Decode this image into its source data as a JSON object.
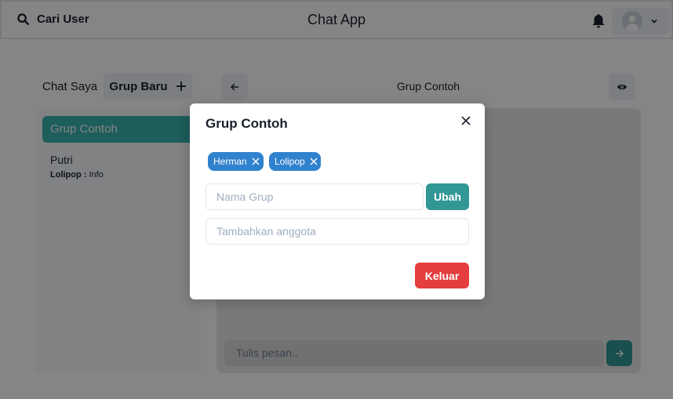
{
  "header": {
    "search_label": "Cari User",
    "app_title": "Chat App"
  },
  "sidebar": {
    "title": "Chat Saya",
    "new_group_label": "Grup Baru",
    "chats": [
      {
        "name": "Grup Contoh",
        "active": true
      },
      {
        "name": "Putri",
        "preview_sender": "Lolipop :",
        "preview_text": "Info"
      }
    ]
  },
  "chat": {
    "title": "Grup Contoh",
    "message_placeholder": "Tulis pesan.."
  },
  "modal": {
    "title": "Grup Contoh",
    "members": [
      "Herman",
      "Lolipop"
    ],
    "group_name_placeholder": "Nama Grup",
    "rename_button": "Ubah",
    "add_member_placeholder": "Tambahkan anggota",
    "leave_button": "Keluar"
  },
  "colors": {
    "accent_teal": "#319795",
    "active_item": "#38b2ac",
    "tag_blue": "#3182ce",
    "danger_red": "#e53e3e"
  },
  "icons": [
    "search-icon",
    "bell-icon",
    "avatar",
    "chevron-down-icon",
    "add-icon",
    "arrow-left-icon",
    "eye-icon",
    "arrow-right-icon",
    "close-icon"
  ]
}
